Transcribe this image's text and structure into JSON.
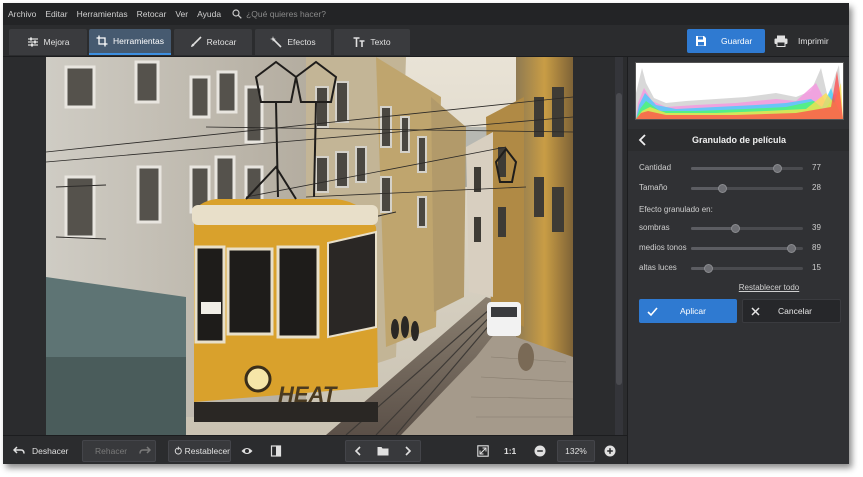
{
  "menu": {
    "items": [
      "Archivo",
      "Editar",
      "Herramientas",
      "Retocar",
      "Ver",
      "Ayuda"
    ],
    "search_placeholder": "¿Qué quieres hacer?"
  },
  "toolbar": {
    "tabs": [
      {
        "label": "Mejora",
        "icon": "sliders-icon"
      },
      {
        "label": "Herramientas",
        "icon": "crop-icon",
        "active": true
      },
      {
        "label": "Retocar",
        "icon": "brush-icon"
      },
      {
        "label": "Efectos",
        "icon": "magic-wand-icon"
      },
      {
        "label": "Texto",
        "icon": "text-icon"
      }
    ],
    "save_label": "Guardar",
    "print_label": "Imprimir"
  },
  "panel": {
    "title": "Granulado de película",
    "sliders": [
      {
        "label": "Cantidad",
        "value": 77
      },
      {
        "label": "Tamaño",
        "value": 28
      }
    ],
    "group_label": "Efecto granulado en:",
    "group_sliders": [
      {
        "label": "sombras",
        "value": 39
      },
      {
        "label": "medios tonos",
        "value": 89
      },
      {
        "label": "altas luces",
        "value": 15
      }
    ],
    "reset_label": "Restablecer todo",
    "apply_label": "Aplicar",
    "cancel_label": "Cancelar"
  },
  "bottombar": {
    "undo_label": "Deshacer",
    "redo_label": "Rehacer",
    "restore_label": "Restablecer",
    "ratio_label": "1:1",
    "zoom_value": "132%"
  },
  "photo": {
    "description_icon": "photo-canvas",
    "tram_text": "HEAT"
  },
  "colors": {
    "accent": "#2f7ad1",
    "background": "#2b2c2e",
    "panel": "#303134",
    "tram_yellow": "#e0a526"
  }
}
